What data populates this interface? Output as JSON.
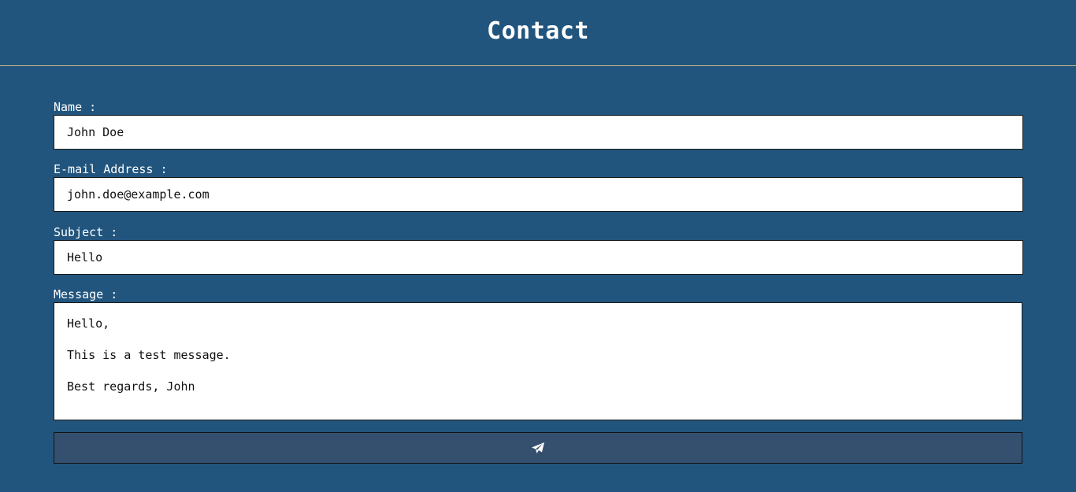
{
  "header": {
    "title": "Contact"
  },
  "form": {
    "name": {
      "label": "Name :",
      "value": "John Doe"
    },
    "email": {
      "label": "E-mail Address :",
      "value": "john.doe@example.com"
    },
    "subject": {
      "label": "Subject :",
      "value": "Hello"
    },
    "message": {
      "label": "Message :",
      "value": "Hello,\n\nThis is a test message.\n\nBest regards, John"
    },
    "submit": {
      "icon": "paper-plane-icon"
    }
  },
  "colors": {
    "background": "#22557d",
    "button": "#34506e",
    "divider": "#c9b98d"
  }
}
